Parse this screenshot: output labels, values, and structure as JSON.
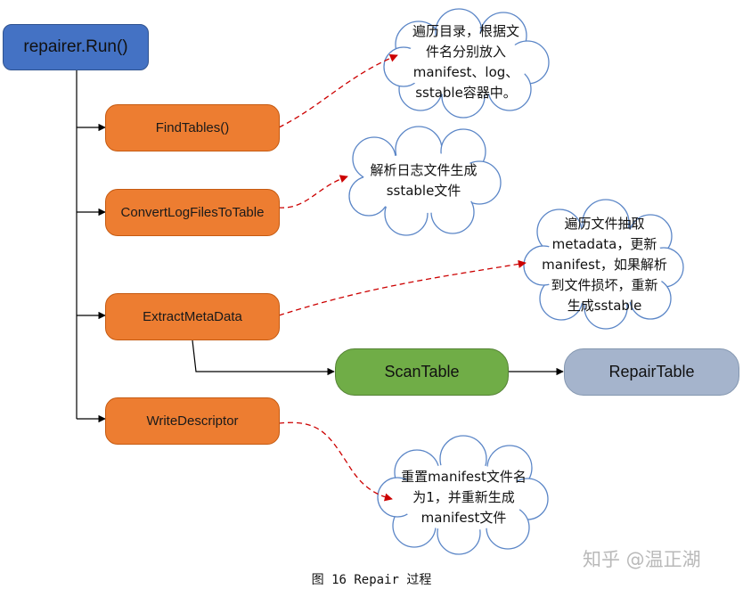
{
  "diagram": {
    "root": "repairer.Run()",
    "steps": [
      "FindTables()",
      "ConvertLogFilesToTable",
      "ExtractMetaData",
      "WriteDescriptor"
    ],
    "scan": "ScanTable",
    "repair": "RepairTable",
    "notes": [
      [
        "遍历目录，根据文",
        "件名分别放入",
        "manifest、log、",
        "sstable容器中。"
      ],
      [
        "解析日志文件生成",
        "sstable文件"
      ],
      [
        "遍历文件抽取",
        "metadata，更新",
        "manifest，如果解析",
        "到文件损坏，重新",
        "生成sstable"
      ],
      [
        "重置manifest文件名",
        "为1，并重新生成",
        "manifest文件"
      ]
    ],
    "caption": "图 16 Repair 过程",
    "watermark": "知乎 @温正湖",
    "colors": {
      "root": "#4472c4",
      "step": "#ed7d31",
      "scan": "#70ad47",
      "repair": "#a5b4cc",
      "annotation_arrow": "#cc0000"
    }
  }
}
